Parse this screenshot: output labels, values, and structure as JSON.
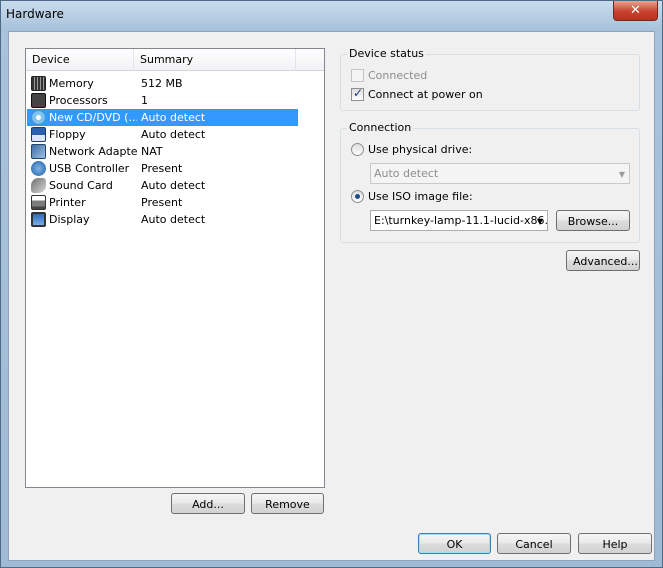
{
  "window": {
    "title": "Hardware",
    "close_glyph": "✕"
  },
  "device_list": {
    "columns": [
      "Device",
      "Summary"
    ],
    "rows": [
      {
        "name": "Memory",
        "summary": "512 MB",
        "icon": "memory-icon"
      },
      {
        "name": "Processors",
        "summary": "1",
        "icon": "processor-icon"
      },
      {
        "name": "New CD/DVD (...",
        "summary": "Auto detect",
        "icon": "cd-dvd-icon",
        "selected": true
      },
      {
        "name": "Floppy",
        "summary": "Auto detect",
        "icon": "floppy-icon"
      },
      {
        "name": "Network Adapter",
        "summary": "NAT",
        "icon": "network-adapter-icon"
      },
      {
        "name": "USB Controller",
        "summary": "Present",
        "icon": "usb-icon"
      },
      {
        "name": "Sound Card",
        "summary": "Auto detect",
        "icon": "sound-card-icon"
      },
      {
        "name": "Printer",
        "summary": "Present",
        "icon": "printer-icon"
      },
      {
        "name": "Display",
        "summary": "Auto detect",
        "icon": "display-icon"
      }
    ],
    "add_label": "Add...",
    "remove_label": "Remove"
  },
  "device_status": {
    "title": "Device status",
    "connected_label": "Connected",
    "connected_checked": false,
    "connect_power_label": "Connect at power on",
    "connect_power_checked": true
  },
  "connection": {
    "title": "Connection",
    "physical_label": "Use physical drive:",
    "physical_value": "Auto detect",
    "iso_label": "Use ISO image file:",
    "iso_value": "E:\\turnkey-lamp-11.1-lucid-x86.",
    "browse_label": "Browse...",
    "selected": "iso"
  },
  "advanced_label": "Advanced...",
  "footer": {
    "ok": "OK",
    "cancel": "Cancel",
    "help": "Help"
  },
  "colors": {
    "selection": "#3399ff",
    "title_gradient": "#a7c1da",
    "close": "#c7432d"
  }
}
